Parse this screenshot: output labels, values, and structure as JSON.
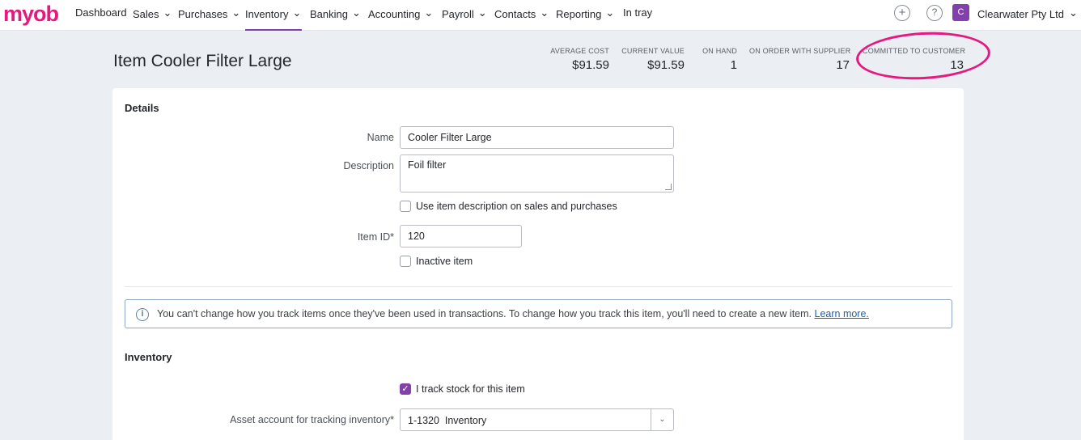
{
  "nav": {
    "logo": "myob",
    "items": [
      {
        "label": "Dashboard",
        "has_menu": false
      },
      {
        "label": "Sales",
        "has_menu": true
      },
      {
        "label": "Purchases",
        "has_menu": true
      },
      {
        "label": "Inventory",
        "has_menu": true,
        "active": true
      },
      {
        "label": "Banking",
        "has_menu": true
      },
      {
        "label": "Accounting",
        "has_menu": true
      },
      {
        "label": "Payroll",
        "has_menu": true
      },
      {
        "label": "Contacts",
        "has_menu": true
      },
      {
        "label": "Reporting",
        "has_menu": true
      },
      {
        "label": "In tray",
        "has_menu": false
      }
    ],
    "create_icon": "plus-circle-icon",
    "help_icon": "question-circle-icon",
    "avatar_initial": "C",
    "company": "Clearwater Pty Ltd",
    "chevron": "⌄"
  },
  "header": {
    "title": "Item Cooler Filter Large",
    "stats": [
      {
        "label": "AVERAGE COST",
        "value": "$91.59"
      },
      {
        "label": "CURRENT VALUE",
        "value": "$91.59"
      },
      {
        "label": "ON HAND",
        "value": "1"
      },
      {
        "label": "ON ORDER WITH SUPPLIER",
        "value": "17"
      },
      {
        "label": "COMMITTED TO CUSTOMER",
        "value": "13"
      }
    ]
  },
  "details": {
    "section_title": "Details",
    "name_label": "Name",
    "name_value": "Cooler Filter Large",
    "description_label": "Description",
    "description_value": "Foil filter",
    "use_desc_label": "Use item description on sales and purchases",
    "use_desc_checked": false,
    "item_id_label": "Item ID",
    "required_mark": "*",
    "item_id_value": "120",
    "inactive_label": "Inactive item",
    "inactive_checked": false
  },
  "info": {
    "icon": "info-icon",
    "text": "You can't change how you track items once they've been used in transactions. To change how you track this item, you'll need to create a new item.",
    "link": "Learn more."
  },
  "inventory": {
    "section_title": "Inventory",
    "track_label": "I track stock for this item",
    "track_checked": true,
    "asset_label": "Asset account for tracking inventory",
    "asset_value": "1-1320  Inventory"
  },
  "colors": {
    "brand": "#e5197e",
    "accent": "#8241aa",
    "link": "#1f5fa8"
  }
}
